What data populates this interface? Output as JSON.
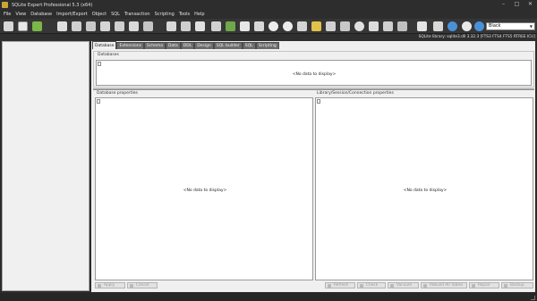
{
  "window": {
    "title": "SQLite Expert Professional 5.3 (x64)",
    "minimize": "–",
    "maximize": "□",
    "close": "✕"
  },
  "menu": [
    "File",
    "View",
    "Database",
    "Import/Export",
    "Object",
    "SQL",
    "Transaction",
    "Scripting",
    "Tools",
    "Help"
  ],
  "toolbar": {
    "style_value": "Black",
    "icons": [
      "new-database-icon",
      "open-database-icon",
      "attach-icon",
      "refresh-icon",
      "new-table-icon",
      "new-view-icon",
      "new-index-icon",
      "new-trigger-icon",
      "export-icon",
      "import-icon",
      "sql-editor-icon",
      "run-query-icon",
      "backup-icon",
      "vacuum-icon",
      "check-icon",
      "options-icon",
      "help-icon",
      "about-icon",
      "web-icon",
      "info-icon"
    ]
  },
  "library_info": "SQLite library: sqlite3.dll 3.32.3 [FTS3 FTS4 FTS5 RTREE ICU]",
  "tabs": [
    "Database",
    "Extensions",
    "Schema",
    "Data",
    "DDL",
    "Design",
    "SQL builder",
    "SQL",
    "Scripting"
  ],
  "active_tab": "Database",
  "sections": {
    "databases_label": "Databases",
    "databases_empty": "<No data to display>",
    "db_props_label": "Database properties",
    "db_props_empty": "<No data to display>",
    "lib_props_label": "Library/Session/Connection properties",
    "lib_props_empty": "<No data to display>"
  },
  "buttons": {
    "apply": "Apply",
    "cancel": "Cancel",
    "refresh": "Refresh",
    "check": "Check",
    "vacuum": "Vacuum",
    "rebuild": "Rebuild All Tables",
    "repair": "Repair",
    "backup": "Backup"
  }
}
